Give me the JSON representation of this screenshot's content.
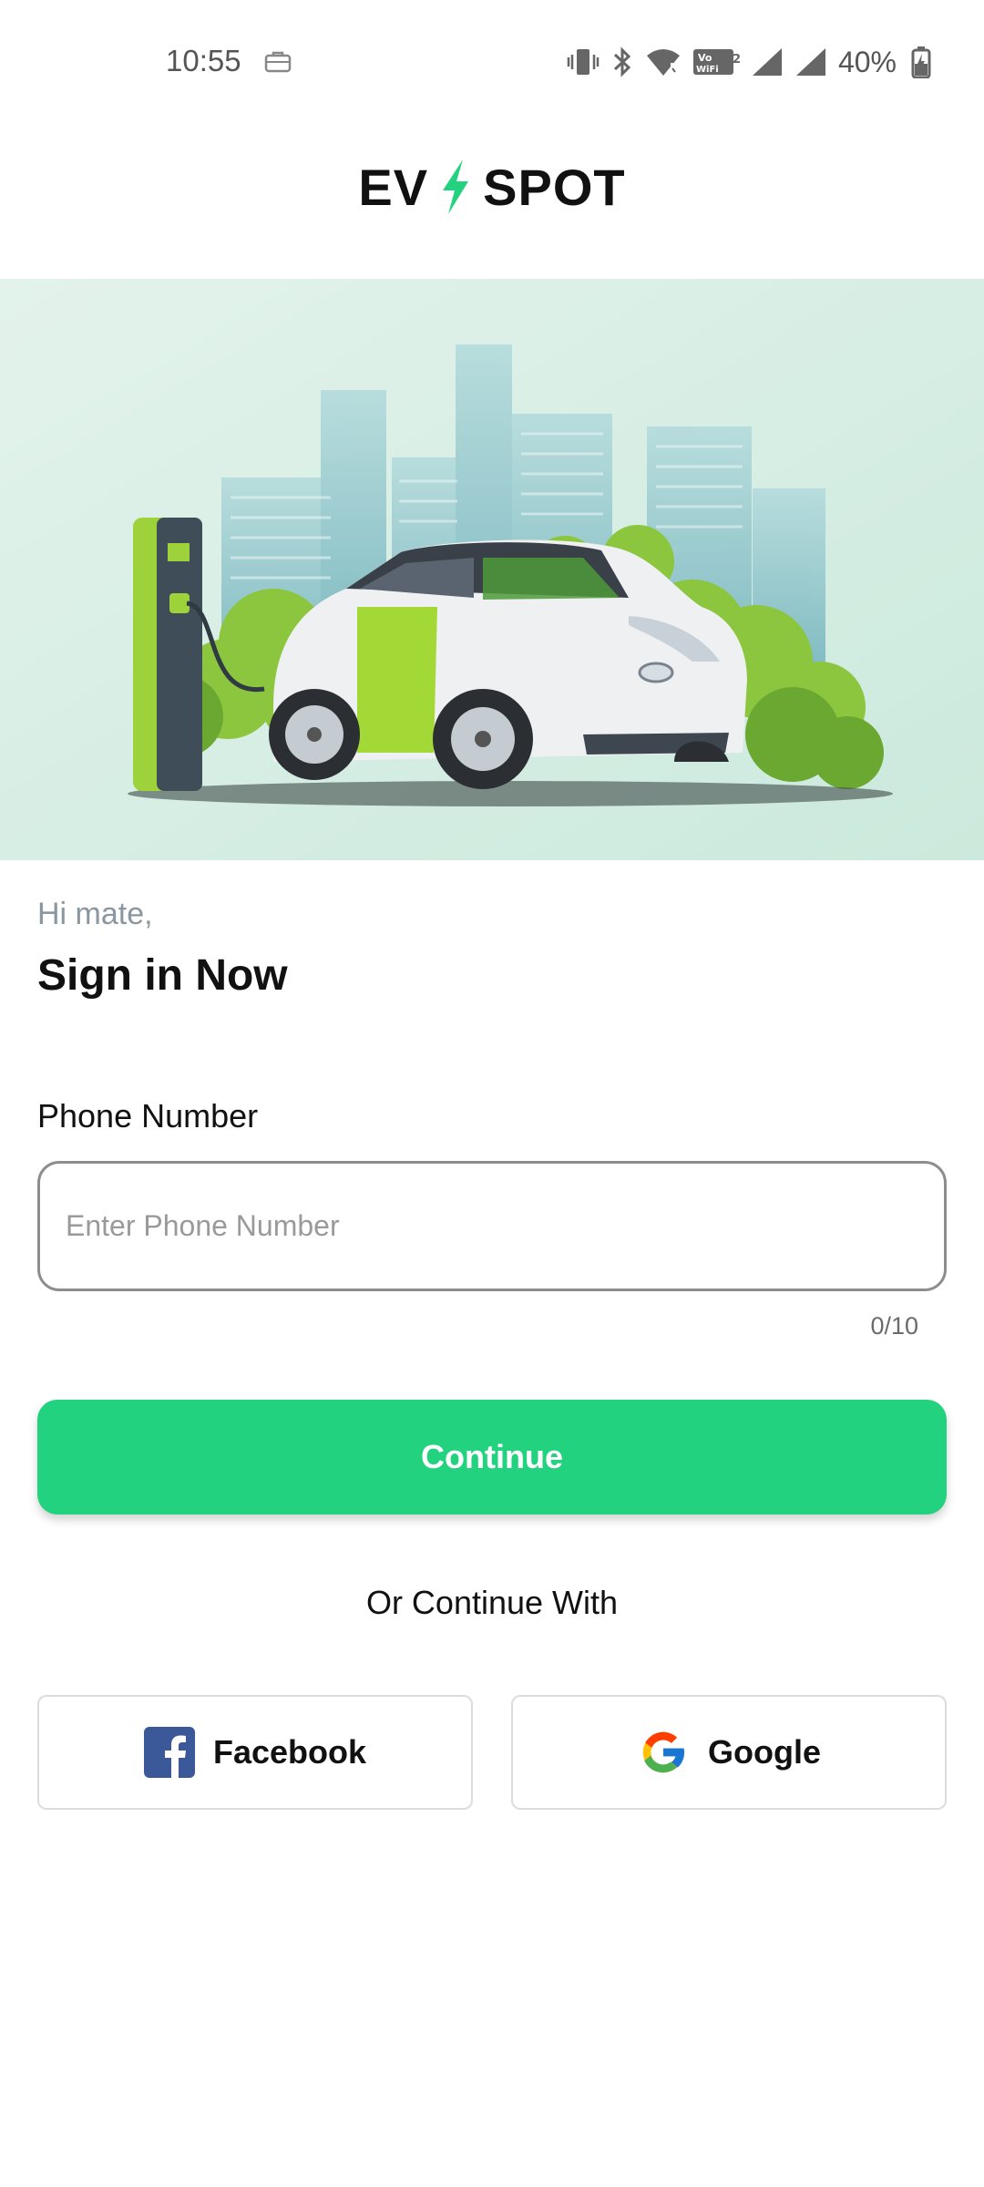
{
  "status_bar": {
    "time": "10:55",
    "battery": "40%",
    "icons": [
      "briefcase-icon",
      "vibrate-icon",
      "bluetooth-icon",
      "wifi-icon",
      "vowifi-icon",
      "signal-icon",
      "signal-icon",
      "battery-charging-icon"
    ]
  },
  "logo": {
    "left_text": "EV",
    "right_text": "SPOT",
    "bolt_color": "#23d27e"
  },
  "hero": {
    "image": "electric-car-charging-illustration"
  },
  "signin": {
    "greeting": "Hi mate,",
    "title": "Sign in Now"
  },
  "form": {
    "phone_label": "Phone Number",
    "phone_placeholder": "Enter Phone Number",
    "phone_value": "",
    "counter": "0/10"
  },
  "actions": {
    "continue_label": "Continue",
    "or_text": "Or Continue With",
    "facebook_label": "Facebook",
    "google_label": "Google"
  },
  "colors": {
    "accent": "#23d27e",
    "facebook": "#3b5998"
  }
}
